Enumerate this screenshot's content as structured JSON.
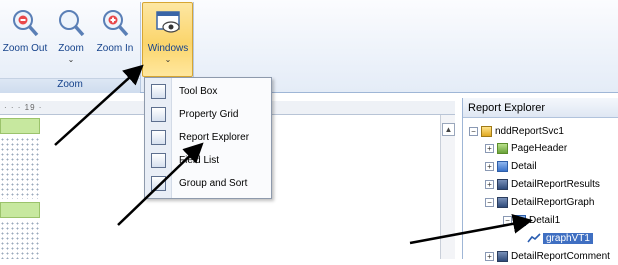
{
  "ribbon": {
    "zoom_out_label": "Zoom Out",
    "zoom_label": "Zoom",
    "zoom_in_label": "Zoom In",
    "windows_label": "Windows",
    "group_label": "Zoom"
  },
  "windows_menu": {
    "items": [
      {
        "label": "Tool Box",
        "icon": "toolbox-icon"
      },
      {
        "label": "Property Grid",
        "icon": "property-grid-icon"
      },
      {
        "label": "Report Explorer",
        "icon": "report-explorer-icon"
      },
      {
        "label": "Field List",
        "icon": "field-list-icon"
      },
      {
        "label": "Group and Sort",
        "icon": "group-sort-icon"
      }
    ]
  },
  "ruler": {
    "text": "· · · 19 ·"
  },
  "report_explorer": {
    "title": "Report Explorer",
    "nodes": [
      {
        "label": "nddReportSvc1"
      },
      {
        "label": "PageHeader"
      },
      {
        "label": "Detail"
      },
      {
        "label": "DetailReportResults"
      },
      {
        "label": "DetailReportGraph"
      },
      {
        "label": "Detail1"
      },
      {
        "label": "graphVT1"
      },
      {
        "label": "DetailReportComment"
      }
    ]
  },
  "colors": {
    "ribbon_text": "#15428b",
    "selected_button": "#fbd56c",
    "band_green": "#c7e89f",
    "tree_selection": "#3f6fc2"
  }
}
